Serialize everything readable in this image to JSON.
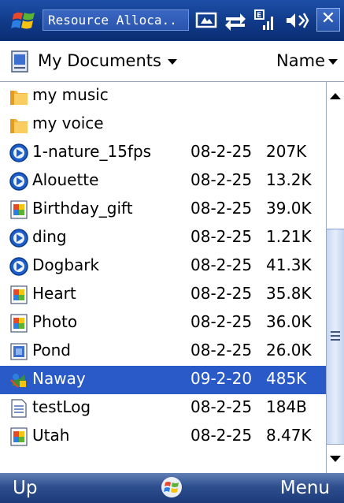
{
  "titlebar": {
    "title": "Resource Alloca..",
    "icons": [
      "windows-start-icon",
      "keyboard-icon",
      "connectivity-icon",
      "signal-icon",
      "volume-icon"
    ],
    "close_label": "✕"
  },
  "header": {
    "folder": "My Documents",
    "sort": "Name"
  },
  "files": [
    {
      "name": "my music",
      "date": "",
      "size": "",
      "icon": "folder-icon"
    },
    {
      "name": "my voice",
      "date": "",
      "size": "",
      "icon": "folder-icon"
    },
    {
      "name": "1-nature_15fps",
      "date": "08-2-25",
      "size": "207K",
      "icon": "media-icon"
    },
    {
      "name": "Alouette",
      "date": "08-2-25",
      "size": "13.2K",
      "icon": "media-icon"
    },
    {
      "name": "Birthday_gift",
      "date": "08-2-25",
      "size": "39.0K",
      "icon": "image-icon"
    },
    {
      "name": "ding",
      "date": "08-2-25",
      "size": "1.21K",
      "icon": "media-icon"
    },
    {
      "name": "Dogbark",
      "date": "08-2-25",
      "size": "41.3K",
      "icon": "media-icon"
    },
    {
      "name": "Heart",
      "date": "08-2-25",
      "size": "35.8K",
      "icon": "image-icon"
    },
    {
      "name": "Photo",
      "date": "08-2-25",
      "size": "36.0K",
      "icon": "image-icon"
    },
    {
      "name": "Pond",
      "date": "08-2-25",
      "size": "26.0K",
      "icon": "picture-icon"
    },
    {
      "name": "Naway",
      "date": "09-2-20",
      "size": "485K",
      "icon": "program-icon",
      "selected": true
    },
    {
      "name": "testLog",
      "date": "08-2-25",
      "size": "184B",
      "icon": "text-file-icon"
    },
    {
      "name": "Utah",
      "date": "08-2-25",
      "size": "8.47K",
      "icon": "image-icon"
    }
  ],
  "softkeys": {
    "left": "Up",
    "right": "Menu",
    "center_icon": "windows-flag-icon"
  },
  "colors": {
    "selection": "#2a5ac8",
    "titlebar": "#103a88",
    "softbar": "#2e4f8f"
  }
}
